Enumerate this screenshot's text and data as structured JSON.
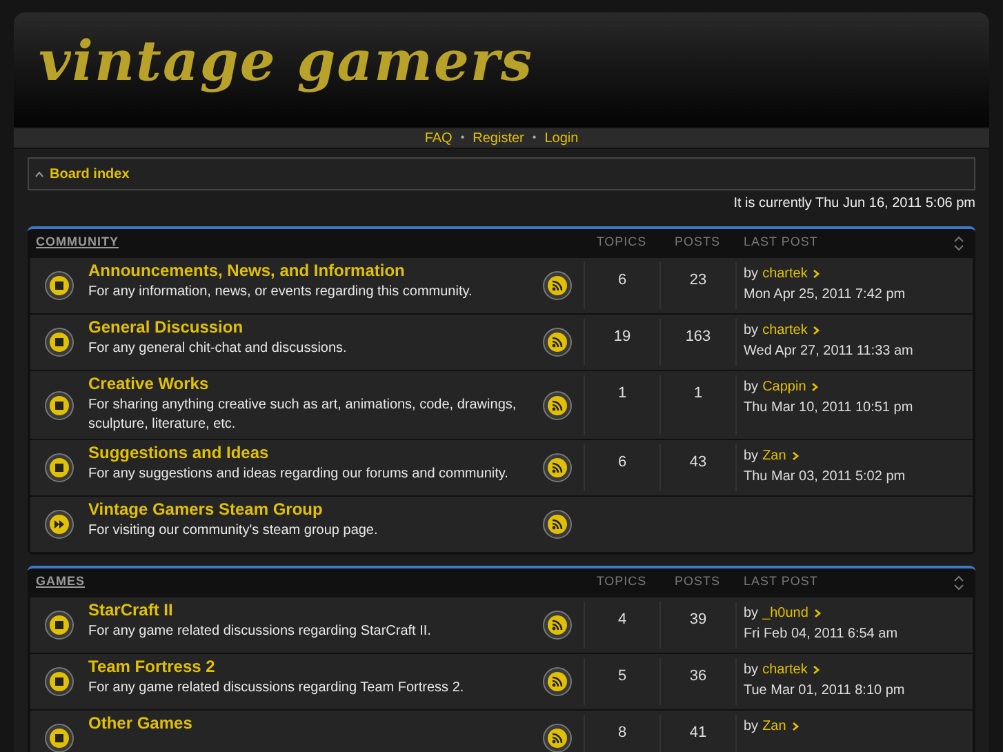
{
  "logo": "vintage gamers",
  "nav": [
    "FAQ",
    "Register",
    "Login"
  ],
  "nav_separator": "•",
  "breadcrumb": "Board index",
  "current_time": "It is currently Thu Jun 16, 2011 5:06 pm",
  "categories": [
    {
      "title": "COMMUNITY",
      "columns": [
        "TOPICS",
        "POSTS",
        "LAST POST"
      ],
      "forums": [
        {
          "kind": "forum",
          "title": "Announcements, News, and Information",
          "description": "For any information, news, or events regarding this community.",
          "topics": "6",
          "posts": "23",
          "last_by": "by",
          "last_user": "chartek",
          "last_date": "Mon Apr 25, 2011 7:42 pm"
        },
        {
          "kind": "forum",
          "title": "General Discussion",
          "description": "For any general chit-chat and discussions.",
          "topics": "19",
          "posts": "163",
          "last_by": "by",
          "last_user": "chartek",
          "last_date": "Wed Apr 27, 2011 11:33 am"
        },
        {
          "kind": "forum",
          "title": "Creative Works",
          "description": "For sharing anything creative such as art, animations, code, drawings, sculpture, literature, etc.",
          "topics": "1",
          "posts": "1",
          "last_by": "by",
          "last_user": "Cappin",
          "last_date": "Thu Mar 10, 2011 10:51 pm"
        },
        {
          "kind": "forum",
          "title": "Suggestions and Ideas",
          "description": "For any suggestions and ideas regarding our forums and community.",
          "topics": "6",
          "posts": "43",
          "last_by": "by",
          "last_user": "Zan",
          "last_date": "Thu Mar 03, 2011 5:02 pm"
        },
        {
          "kind": "link",
          "title": "Vintage Gamers Steam Group",
          "description": "For visiting our community's steam group page."
        }
      ]
    },
    {
      "title": "GAMES",
      "columns": [
        "TOPICS",
        "POSTS",
        "LAST POST"
      ],
      "forums": [
        {
          "kind": "forum",
          "title": "StarCraft II",
          "description": "For any game related discussions regarding StarCraft II.",
          "topics": "4",
          "posts": "39",
          "last_by": "by",
          "last_user": "_h0und",
          "last_date": "Fri Feb 04, 2011 6:54 am"
        },
        {
          "kind": "forum",
          "title": "Team Fortress 2",
          "description": "For any game related discussions regarding Team Fortress 2.",
          "topics": "5",
          "posts": "36",
          "last_by": "by",
          "last_user": "chartek",
          "last_date": "Tue Mar 01, 2011 8:10 pm"
        },
        {
          "kind": "forum",
          "title": "Other Games",
          "topics": "8",
          "posts": "41",
          "last_by": "by",
          "last_user": "Zan"
        }
      ]
    }
  ]
}
